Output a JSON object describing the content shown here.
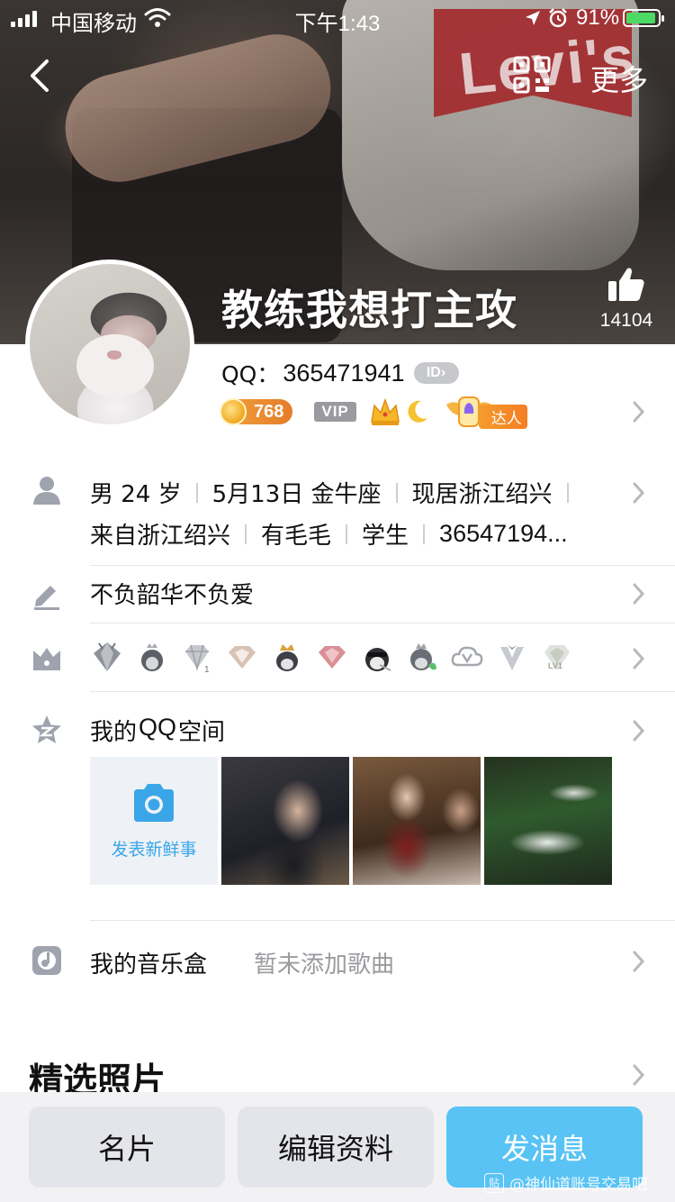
{
  "status_bar": {
    "carrier": "中国移动",
    "time": "下午1:43",
    "battery": "91%"
  },
  "nav": {
    "back_icon": "chevron-left-icon",
    "qr_icon": "qr-code-icon",
    "more_label": "更多"
  },
  "profile": {
    "nickname": "教练我想打主攻",
    "like_count": "14104",
    "qq_label": "QQ：",
    "qq_number": "365471941",
    "id_badge": "ID",
    "coin_value": "768",
    "vip_label": "VIP",
    "daren_label": "达人"
  },
  "info": {
    "gender_age": "男 24 岁",
    "birthday": "5月13日 金牛座",
    "location": "现居浙江绍兴",
    "hometown": "来自浙江绍兴",
    "pet": "有毛毛",
    "occupation": "学生",
    "truncated_number": "36547194..."
  },
  "signature": "不负韶华不负爱",
  "honors": {
    "icons": [
      "diamond-shield-icon",
      "penguin-crown-icon",
      "diamond-icon",
      "pink-diamond-icon",
      "penguin-king-icon",
      "red-diamond-icon",
      "penguin-glasses-icon",
      "penguin-leaf-icon",
      "cloud-v-icon",
      "tuxedo-v-icon",
      "lv1-diamond-icon"
    ]
  },
  "qzone": {
    "title_pre": "我的",
    "title_qq": "QQ",
    "title_post": "空间",
    "post_label": "发表新鲜事"
  },
  "music": {
    "title": "我的音乐盒",
    "empty": "暂未添加歌曲"
  },
  "photos_section": "精选照片",
  "actions": {
    "card": "名片",
    "edit": "编辑资料",
    "message": "发消息"
  },
  "watermark": "@神仙道账号交易吧",
  "colors": {
    "accent": "#58c3f4",
    "qzone_blue": "#3aa6e8",
    "coin_orange": "#e47d28",
    "battery_green": "#4cd964"
  }
}
